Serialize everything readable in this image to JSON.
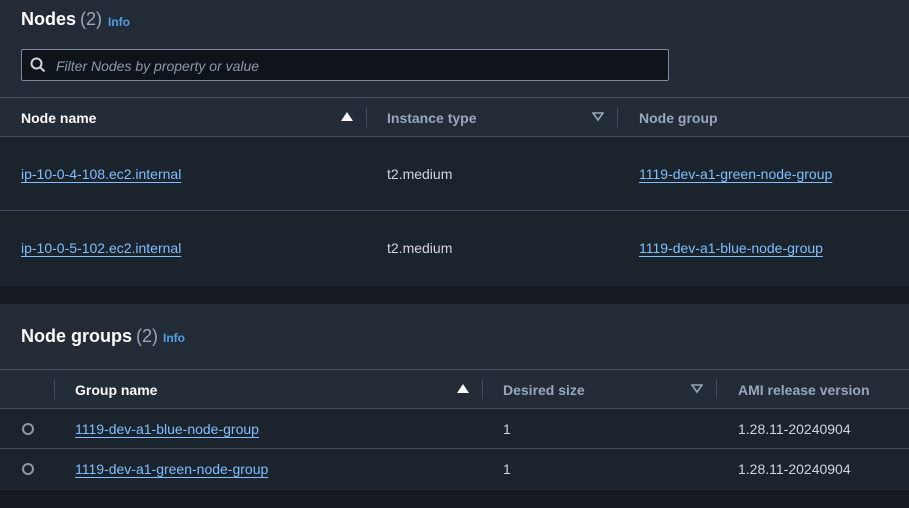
{
  "nodes": {
    "title": "Nodes",
    "count": "(2)",
    "info": "Info",
    "filter_placeholder": "Filter Nodes by property or value",
    "columns": [
      "Node name",
      "Instance type",
      "Node group"
    ],
    "rows": [
      {
        "name": "ip-10-0-4-108.ec2.internal",
        "instance_type": "t2.medium",
        "node_group": "1119-dev-a1-green-node-group"
      },
      {
        "name": "ip-10-0-5-102.ec2.internal",
        "instance_type": "t2.medium",
        "node_group": "1119-dev-a1-blue-node-group"
      }
    ]
  },
  "node_groups": {
    "title": "Node groups",
    "count": "(2)",
    "info": "Info",
    "columns": [
      "Group name",
      "Desired size",
      "AMI release version"
    ],
    "rows": [
      {
        "name": "1119-dev-a1-blue-node-group",
        "desired_size": "1",
        "ami": "1.28.11-20240904"
      },
      {
        "name": "1119-dev-a1-green-node-group",
        "desired_size": "1",
        "ami": "1.28.11-20240904"
      }
    ]
  },
  "colors": {
    "background": "#16191f",
    "panel": "#232b37",
    "link": "#7fbfff",
    "info": "#539fe5"
  },
  "icons": {
    "search": "search-icon",
    "sort_asc": "sort-ascending-icon",
    "sort_none": "sort-descending-icon"
  }
}
